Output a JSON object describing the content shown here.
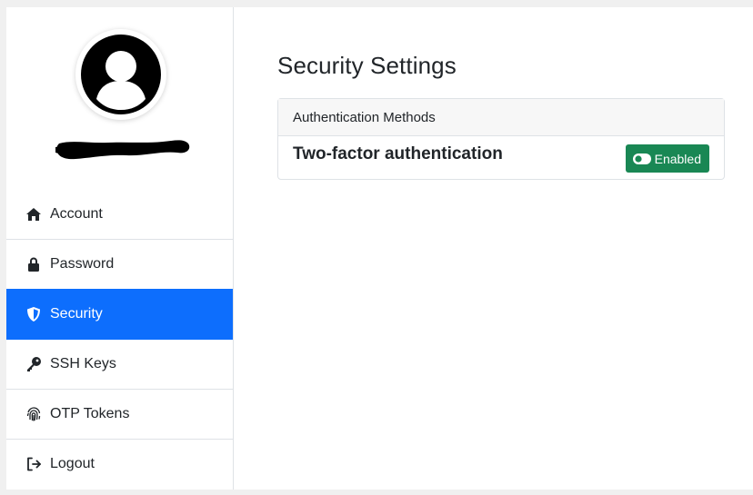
{
  "sidebar": {
    "items": [
      {
        "label": "Account",
        "icon": "home-icon",
        "active": false
      },
      {
        "label": "Password",
        "icon": "lock-icon",
        "active": false
      },
      {
        "label": "Security",
        "icon": "shield-icon",
        "active": true
      },
      {
        "label": "SSH Keys",
        "icon": "key-icon",
        "active": false
      },
      {
        "label": "OTP Tokens",
        "icon": "fingerprint-icon",
        "active": false
      },
      {
        "label": "Logout",
        "icon": "logout-icon",
        "active": false
      }
    ]
  },
  "main": {
    "title": "Security Settings",
    "card": {
      "header": "Authentication Methods",
      "rows": [
        {
          "label": "Two-factor authentication",
          "status": "Enabled",
          "status_icon": "toggle-on-icon"
        }
      ]
    }
  },
  "colors": {
    "accent": "#0d6efd",
    "success": "#198754",
    "border": "#dee2e6",
    "header_bg": "#f7f7f7"
  }
}
